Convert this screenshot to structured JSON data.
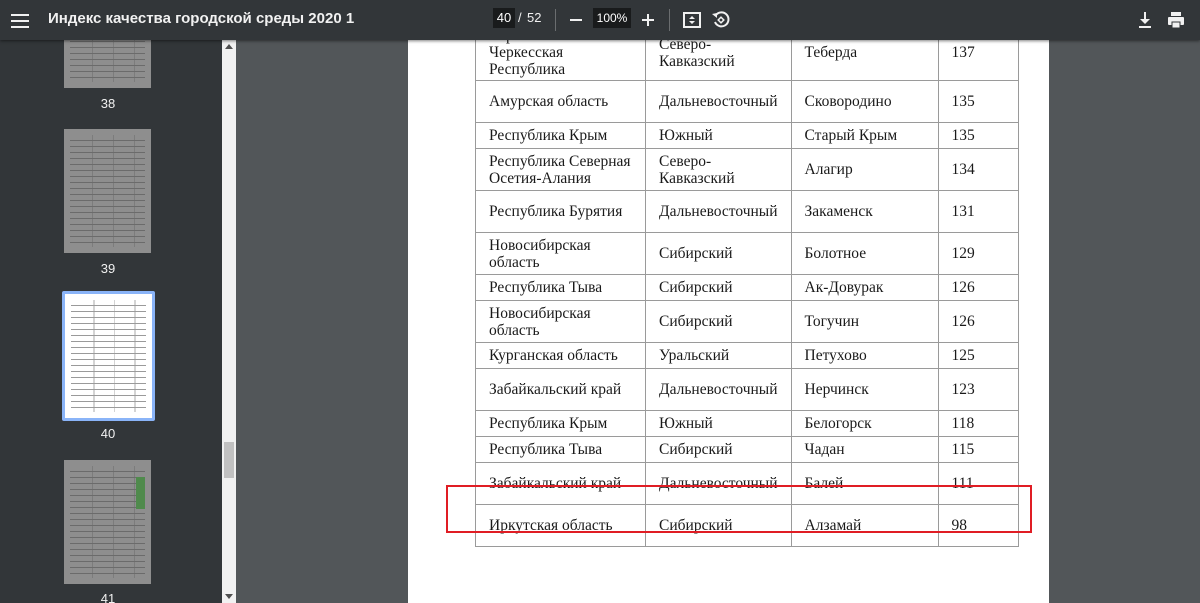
{
  "toolbar": {
    "title": "Индекс качества городской среды 2020 1",
    "current_page": "40",
    "separator": "/",
    "total_pages": "52",
    "zoom": "100%",
    "zoom_out_icon": "minus-icon",
    "zoom_in_icon": "plus-icon",
    "fit_icon": "fit-page-icon",
    "rotate_icon": "rotate-icon",
    "download_icon": "download-icon",
    "print_icon": "print-icon"
  },
  "sidebar": {
    "thumbnails": [
      {
        "label": "38"
      },
      {
        "label": "39"
      },
      {
        "label": "40"
      },
      {
        "label": "41"
      }
    ]
  },
  "table": {
    "rows": [
      {
        "region": "Карачаево-Черкесская Республика",
        "district": "Северо-Кавказский",
        "city": "Теберда",
        "score": "137"
      },
      {
        "region": "Амурская область",
        "district": "Дальневосточный",
        "city": "Сковородино",
        "score": "135"
      },
      {
        "region": "Республика Крым",
        "district": "Южный",
        "city": "Старый Крым",
        "score": "135"
      },
      {
        "region": "Республика Северная Осетия-Алания",
        "district": "Северо-Кавказский",
        "city": "Алагир",
        "score": "134"
      },
      {
        "region": "Республика Бурятия",
        "district": "Дальневосточный",
        "city": "Закаменск",
        "score": "131"
      },
      {
        "region": "Новосибирская область",
        "district": "Сибирский",
        "city": "Болотное",
        "score": "129"
      },
      {
        "region": "Республика Тыва",
        "district": "Сибирский",
        "city": "Ак-Довурак",
        "score": "126"
      },
      {
        "region": "Новосибирская область",
        "district": "Сибирский",
        "city": "Тогучин",
        "score": "126"
      },
      {
        "region": "Курганская область",
        "district": "Уральский",
        "city": "Петухово",
        "score": "125"
      },
      {
        "region": "Забайкальский край",
        "district": "Дальневосточный",
        "city": "Нерчинск",
        "score": "123"
      },
      {
        "region": "Республика Крым",
        "district": "Южный",
        "city": "Белогорск",
        "score": "118"
      },
      {
        "region": "Республика Тыва",
        "district": "Сибирский",
        "city": "Чадан",
        "score": "115"
      },
      {
        "region": "Забайкальский край",
        "district": "Дальневосточный",
        "city": "Балей",
        "score": "111"
      },
      {
        "region": "Иркутская область",
        "district": "Сибирский",
        "city": "Алзамай",
        "score": "98"
      }
    ]
  },
  "colors": {
    "toolbar_bg": "#323639",
    "viewer_bg": "#525659",
    "selection": "#8ab4f8",
    "highlight": "#e01d24"
  }
}
